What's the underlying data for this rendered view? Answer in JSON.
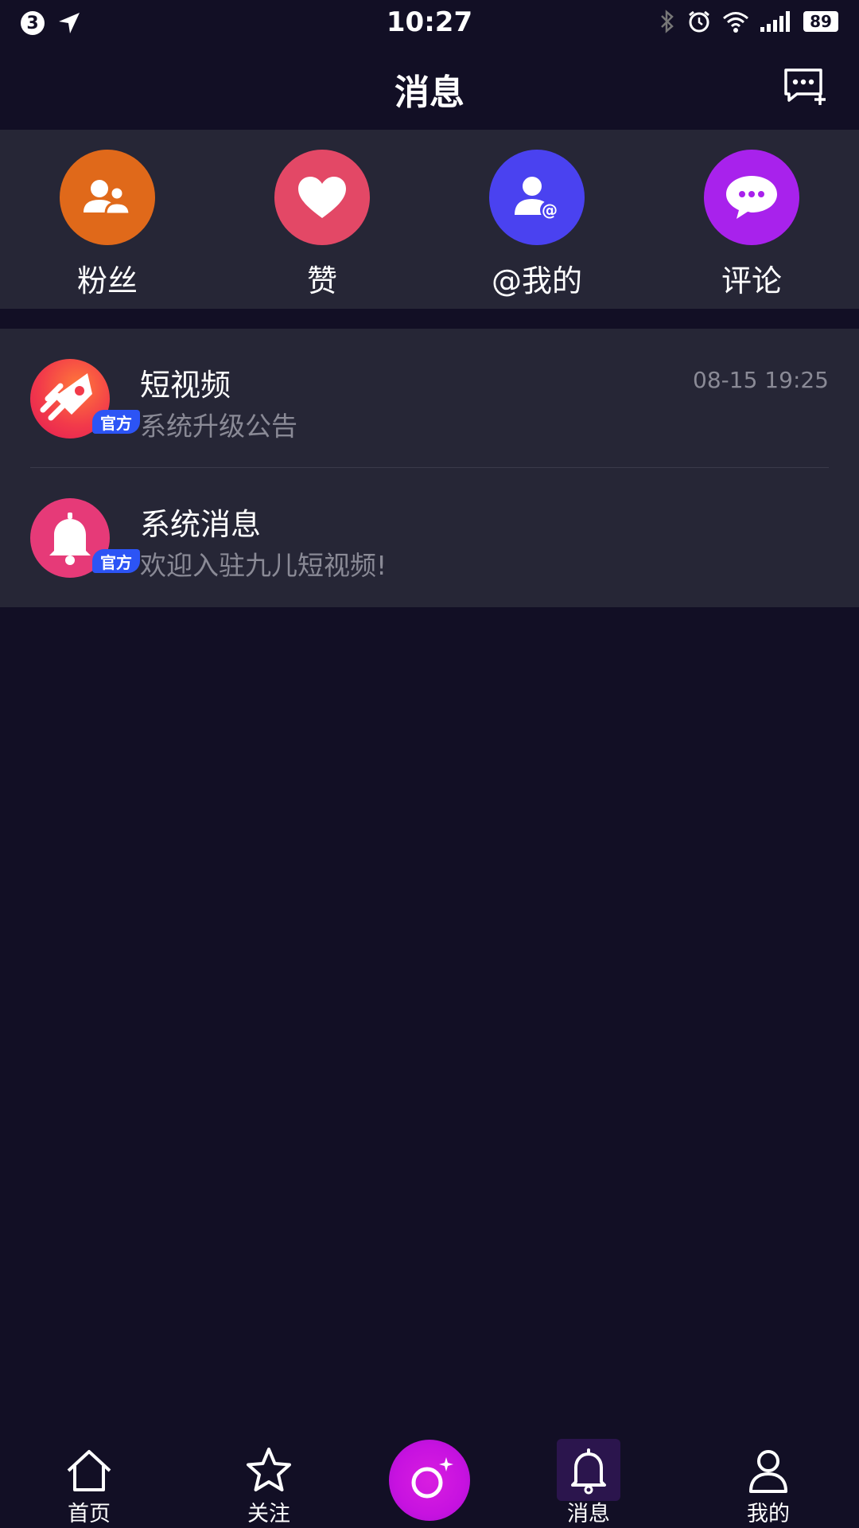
{
  "status_bar": {
    "badge": "3",
    "time": "10:27",
    "battery": "89"
  },
  "header": {
    "title": "消息"
  },
  "shortcuts": [
    {
      "label": "粉丝",
      "icon": "fans-icon",
      "color": "#e0691a"
    },
    {
      "label": "赞",
      "icon": "heart-icon",
      "color": "#e34866"
    },
    {
      "label": "@我的",
      "icon": "mention-user-icon",
      "color": "#4a42f0"
    },
    {
      "label": "评论",
      "icon": "comment-icon",
      "color": "#a822ec"
    }
  ],
  "messages": [
    {
      "title": "短视频",
      "subtitle": "系统升级公告",
      "time": "08-15 19:25",
      "badge": "官方",
      "icon": "rocket-logo-icon"
    },
    {
      "title": "系统消息",
      "subtitle": "欢迎入驻九儿短视频!",
      "time": "",
      "badge": "官方",
      "icon": "bell-icon"
    }
  ],
  "bottom_nav": {
    "items": [
      {
        "label": "首页",
        "icon": "home-icon"
      },
      {
        "label": "关注",
        "icon": "star-icon"
      },
      {
        "label": "",
        "icon": "camera-icon"
      },
      {
        "label": "消息",
        "icon": "bell-icon",
        "active": true
      },
      {
        "label": "我的",
        "icon": "profile-icon"
      }
    ]
  },
  "colors": {
    "background": "#120f25",
    "panel": "#262636",
    "accent": "#c712e0"
  }
}
